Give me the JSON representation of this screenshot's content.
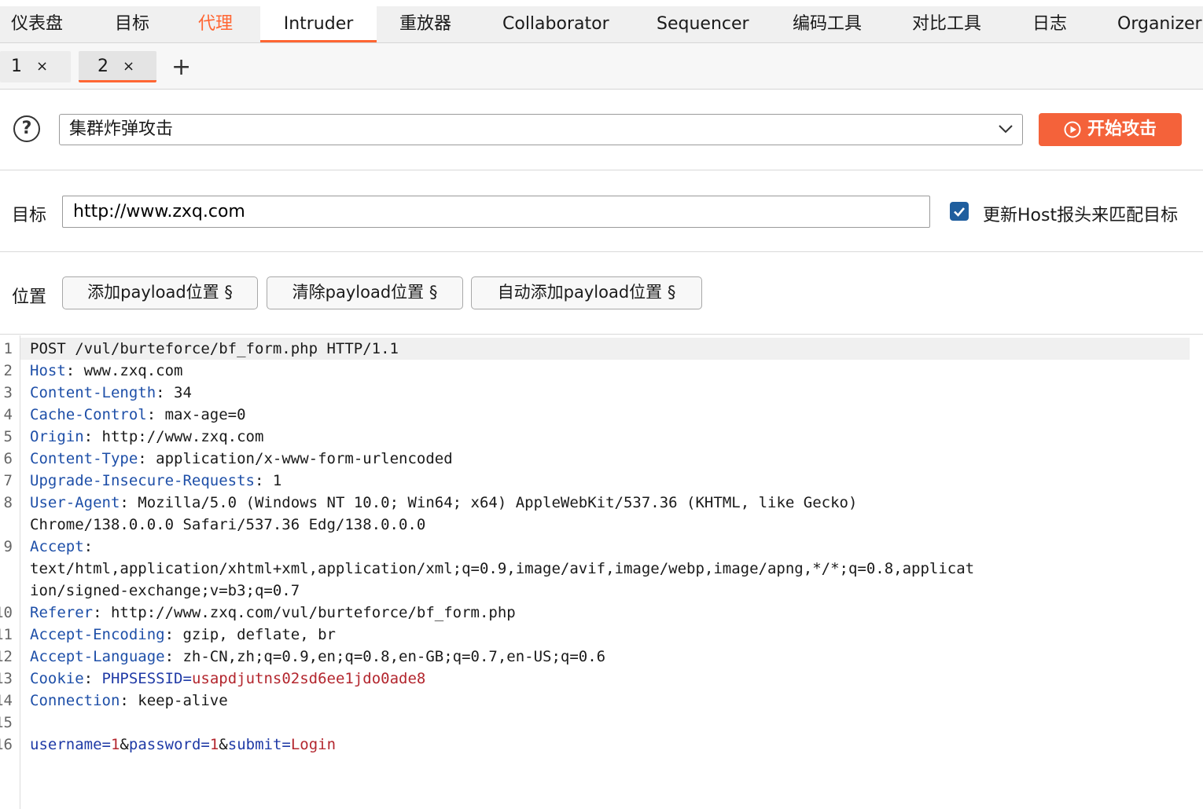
{
  "top_tabs": [
    {
      "label": "仪表盘"
    },
    {
      "label": "目标"
    },
    {
      "label": "代理"
    },
    {
      "label": "Intruder"
    },
    {
      "label": "重放器"
    },
    {
      "label": "Collaborator"
    },
    {
      "label": "Sequencer"
    },
    {
      "label": "编码工具"
    },
    {
      "label": "对比工具"
    },
    {
      "label": "日志"
    },
    {
      "label": "Organizer"
    }
  ],
  "sub_tabs": [
    {
      "label": "1",
      "close": "×"
    },
    {
      "label": "2",
      "close": "×"
    }
  ],
  "add_tab": "+",
  "attack": {
    "help_icon": "?",
    "type_value": "集群炸弹攻击",
    "start_label": "开始攻击"
  },
  "target": {
    "label": "目标",
    "value": "http://www.zxq.com",
    "update_host_checked": true,
    "update_host_label": "更新Host报头来匹配目标"
  },
  "positions": {
    "label": "位置",
    "add_label": "添加payload位置 §",
    "clear_label": "清除payload位置 §",
    "auto_label": "自动添加payload位置 §"
  },
  "request": {
    "line_numbers": [
      "1",
      "2",
      "3",
      "4",
      "5",
      "6",
      "7",
      "8",
      "9",
      "10",
      "11",
      "12",
      "13",
      "14",
      "15",
      "16"
    ],
    "request_line": "POST /vul/burteforce/bf_form.php HTTP/1.1",
    "headers": [
      {
        "name": "Host",
        "value": "www.zxq.com"
      },
      {
        "name": "Content-Length",
        "value": "34"
      },
      {
        "name": "Cache-Control",
        "value": "max-age=0"
      },
      {
        "name": "Origin",
        "value": "http://www.zxq.com"
      },
      {
        "name": "Content-Type",
        "value": "application/x-www-form-urlencoded"
      },
      {
        "name": "Upgrade-Insecure-Requests",
        "value": "1"
      },
      {
        "name": "User-Agent",
        "value": "Mozilla/5.0 (Windows NT 10.0; Win64; x64) AppleWebKit/537.36 (KHTML, like Gecko)",
        "cont": "Chrome/138.0.0.0 Safari/537.36 Edg/138.0.0.0"
      },
      {
        "name": "Accept",
        "value": "",
        "cont": "text/html,application/xhtml+xml,application/xml;q=0.9,image/avif,image/webp,image/apng,*/*;q=0.8,applicat",
        "cont2": "ion/signed-exchange;v=b3;q=0.7"
      },
      {
        "name": "Referer",
        "value": "http://www.zxq.com/vul/burteforce/bf_form.php"
      },
      {
        "name": "Accept-Encoding",
        "value": "gzip, deflate, br"
      },
      {
        "name": "Accept-Language",
        "value": "zh-CN,zh;q=0.9,en;q=0.8,en-GB;q=0.7,en-US;q=0.6"
      },
      {
        "name": "Cookie",
        "cookie_key": "PHPSESSID",
        "cookie_val": "usapdjutns02sd6ee1jdo0ade8"
      },
      {
        "name": "Connection",
        "value": "keep-alive"
      }
    ],
    "body": [
      {
        "key": "username",
        "val": "1"
      },
      {
        "key": "password",
        "val": "1"
      },
      {
        "key": "submit",
        "val": "Login"
      }
    ]
  },
  "colors": {
    "accent": "#ff6633",
    "start_button": "#f4623a",
    "header_name": "#1e4fa8",
    "param_value": "#b3262e",
    "checkbox": "#1f5e9e"
  }
}
